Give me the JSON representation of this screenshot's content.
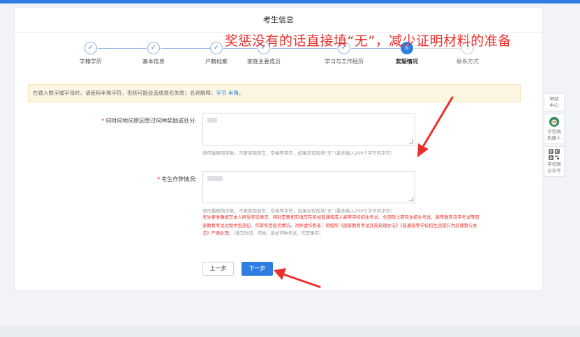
{
  "header": {
    "title": "考生信息"
  },
  "annotation": {
    "text": "奖惩没有的话直接填“无”，减少证明材料的准备"
  },
  "steps": [
    {
      "label": "学籍学历",
      "marker": "✓",
      "state": "done"
    },
    {
      "label": "基本信息",
      "marker": "✓",
      "state": "done"
    },
    {
      "label": "户籍档案",
      "marker": "✓",
      "state": "done"
    },
    {
      "label": "家庭主要成员",
      "marker": "✓",
      "state": "done"
    },
    {
      "label": "学习与工作经历",
      "marker": "✓",
      "state": "done"
    },
    {
      "label": "奖惩情况",
      "marker": "6",
      "state": "active"
    },
    {
      "label": "联系方式",
      "marker": "7",
      "state": "pending"
    }
  ],
  "notice": {
    "text": "在输入数字或字母时，请使用半角字符，否则可能会造成报名失败；名词解释：",
    "link_text": "字节 半角",
    "suffix": "。"
  },
  "form": {
    "awards": {
      "required_mark": "*",
      "label": "何时何地何原因受过何种奖励或处分:",
      "hint": "请尽量精简字数，不要使用回车、空格等字符，如果没有就填“无”（最多输入200个字节的字符）"
    },
    "cheating": {
      "required_mark": "*",
      "label": "考生作弊情况:",
      "hint": "请尽量精简字数，不要使用回车、空格等字符，如果没有就填“无”（最多输入250个字节的字符）",
      "warning": "考生要准确填写本人所受奖惩情况，特别是要如实填写在参加普通和成人高等学校招生考试、全国硕士研究生招生考试、高等教育自学考试等国家教育考试过程中因违纪、作弊所受处罚情况。对弄虚作假者，将按照《国家教育考试违规处理办法》《普通高等学校招生违规行为处理暂行办法》严肃处理。",
      "warning_note": "（填写时间、何地、参加何种考试、作弊事实）"
    }
  },
  "buttons": {
    "prev": "上一步",
    "next": "下一步"
  },
  "sidebar": {
    "help": "帮助中心",
    "robot": "学信网机器人",
    "wechat": "学信网公众号"
  },
  "colors": {
    "accent": "#2f7de1",
    "warning": "#e8302d",
    "notice_bg": "#fdf6e3"
  }
}
